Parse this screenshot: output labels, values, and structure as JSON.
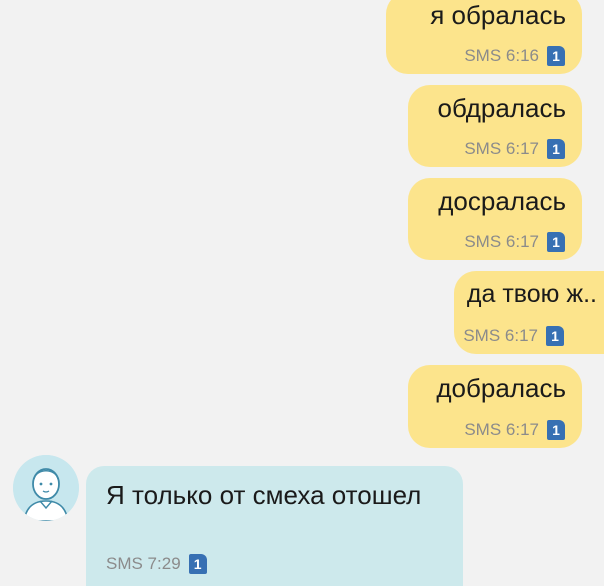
{
  "messages": [
    {
      "text": "я обралась",
      "meta": "SMS 6:16",
      "sim": "1"
    },
    {
      "text": "обдралась",
      "meta": "SMS 6:17",
      "sim": "1"
    },
    {
      "text": "досралась",
      "meta": "SMS 6:17",
      "sim": "1"
    },
    {
      "text": "да твою ж..",
      "meta": "SMS 6:17",
      "sim": "1"
    },
    {
      "text": "добралась",
      "meta": "SMS 6:17",
      "sim": "1"
    },
    {
      "text": "Я только от смеха отошел",
      "meta": "SMS 7:29",
      "sim": "1"
    }
  ],
  "avatar": {
    "icon": "default-person-avatar-icon"
  },
  "colors": {
    "outgoing_bubble": "#fce48c",
    "incoming_bubble": "#cde9ec",
    "sim_badge": "#3770b3",
    "background": "#f2f2f2"
  }
}
